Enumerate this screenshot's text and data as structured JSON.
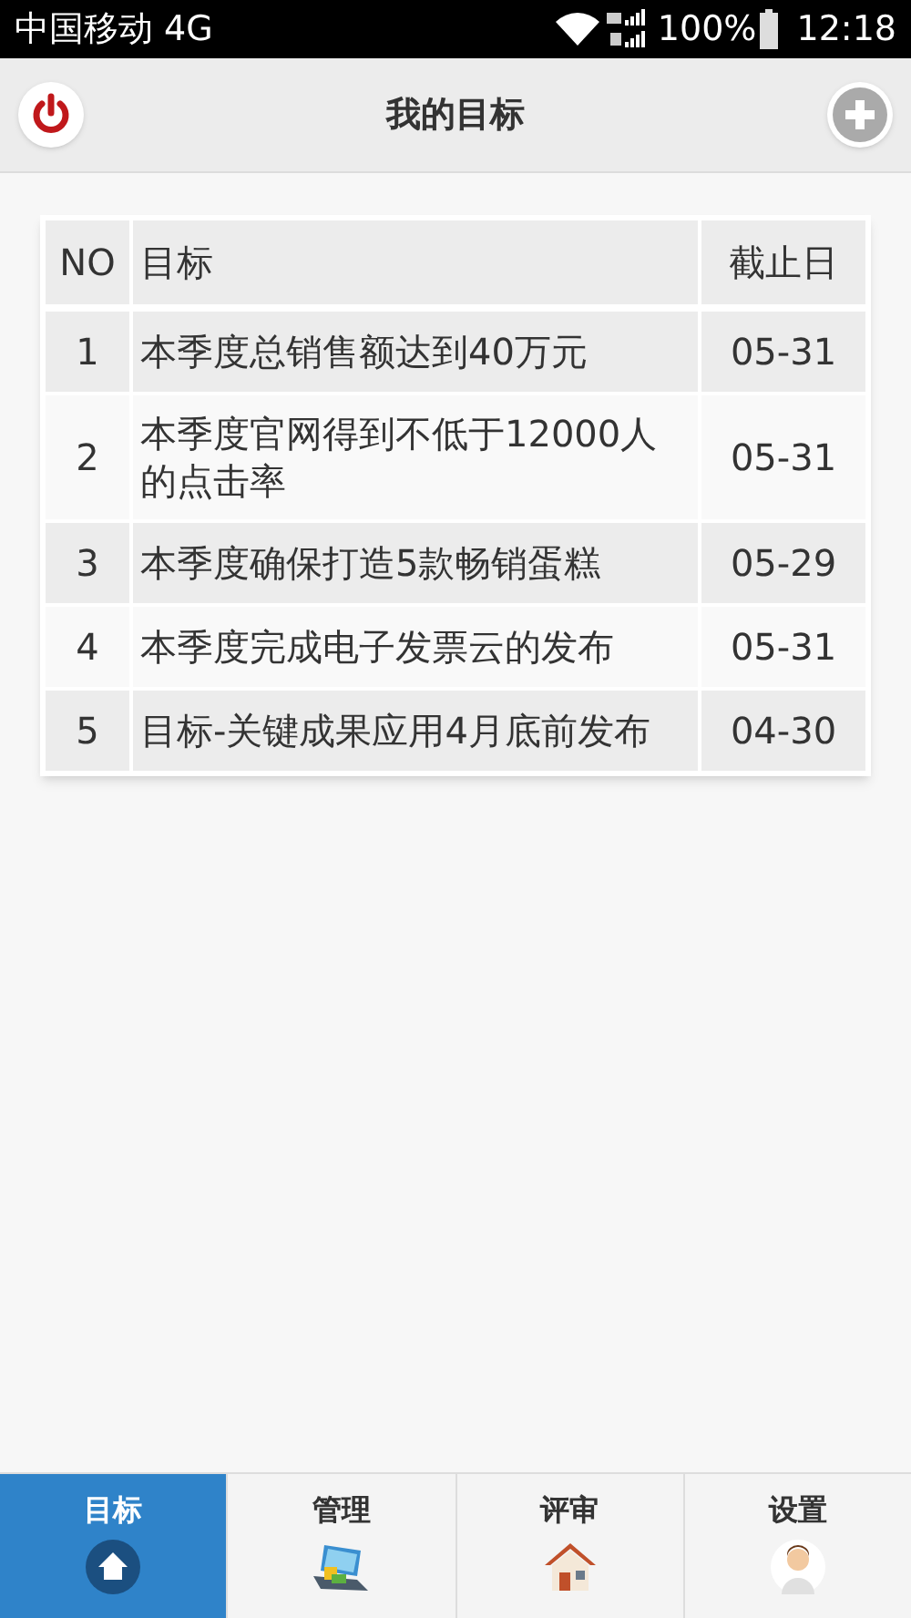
{
  "status_bar": {
    "carrier": "中国移动 4G",
    "battery": "100%",
    "time": "12:18"
  },
  "header": {
    "title": "我的目标"
  },
  "table": {
    "columns": [
      "NO",
      "目标",
      "截止日"
    ],
    "rows": [
      {
        "no": "1",
        "goal": "本季度总销售额达到40万元",
        "deadline": "05-31"
      },
      {
        "no": "2",
        "goal": "本季度官网得到不低于12000人的点击率",
        "deadline": "05-31"
      },
      {
        "no": "3",
        "goal": "本季度确保打造5款畅销蛋糕",
        "deadline": "05-29"
      },
      {
        "no": "4",
        "goal": "本季度完成电子发票云的发布",
        "deadline": "05-31"
      },
      {
        "no": "5",
        "goal": "目标-关键成果应用4月底前发布",
        "deadline": "04-30"
      }
    ]
  },
  "tabs": [
    {
      "label": "目标",
      "selected": true,
      "kind": "home"
    },
    {
      "label": "管理",
      "selected": false,
      "kind": "laptop"
    },
    {
      "label": "评审",
      "selected": false,
      "kind": "house"
    },
    {
      "label": "设置",
      "selected": false,
      "kind": "person"
    }
  ]
}
